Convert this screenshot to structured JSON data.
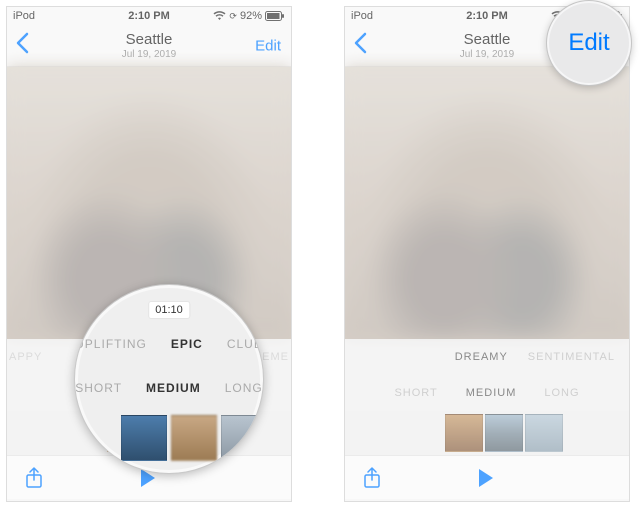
{
  "status": {
    "carrier": "iPod",
    "time": "2:10 PM",
    "battery_percent": "92%"
  },
  "nav": {
    "title": "Seattle",
    "subtitle": "Jul 19, 2019",
    "edit_label": "Edit"
  },
  "magnifier_left": {
    "duration_badge": "01:10",
    "mood": {
      "left": "UPLIFTING",
      "center": "EPIC",
      "right": "CLUB"
    },
    "duration": {
      "left": "SHORT",
      "center": "MEDIUM",
      "right": "LONG"
    }
  },
  "left_screen": {
    "mood_edge_left": "APPY",
    "mood_edge_right": "XTREME"
  },
  "right_screen": {
    "mood": {
      "center": "DREAMY",
      "right": "SENTIMENTAL"
    },
    "duration": {
      "left": "SHORT",
      "center": "MEDIUM",
      "right": "LONG"
    }
  },
  "magnifier_right": {
    "edit_label": "Edit"
  }
}
